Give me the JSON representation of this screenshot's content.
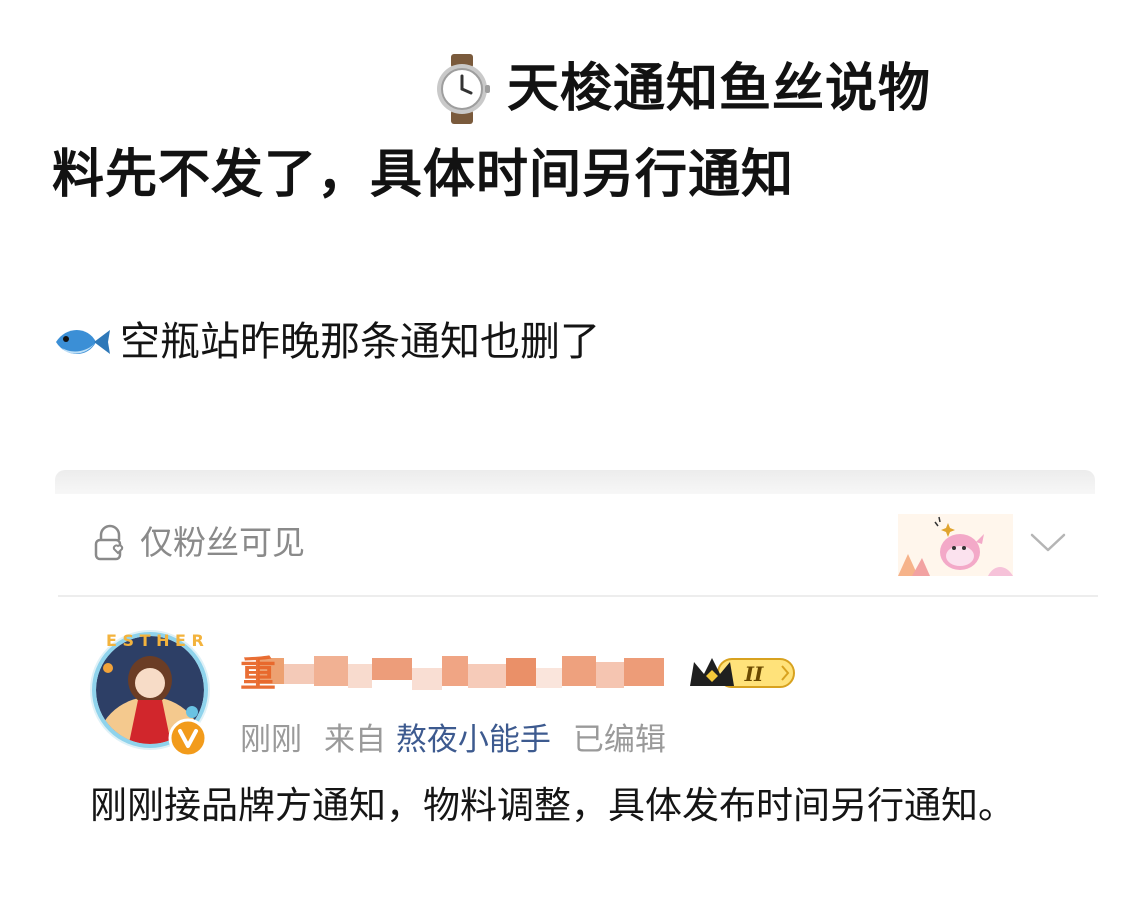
{
  "caption": {
    "emoji": "watch-emoji",
    "line1": "天梭通知鱼丝说物",
    "line2": "料先不发了，具体时间另行通知",
    "sub_emoji": "fish-emoji",
    "sub_text": "空瓶站昨晚那条通知也删了"
  },
  "post": {
    "visibility_label": "仅粉丝可见",
    "author": {
      "name_visible_prefix": "重",
      "name_obscured": true,
      "verified": true,
      "vip_level": "II"
    },
    "meta": {
      "time": "刚刚",
      "from_label": "来自",
      "source_app": "熬夜小能手",
      "edited_label": "已编辑"
    },
    "body_text": "刚刚接品牌方通知，物料调整，具体发布时间另行通知。"
  },
  "colors": {
    "source_link": "#3d5a8f",
    "meta_gray": "#9a9a9a",
    "username_orange": "#e8672a",
    "verified_orange": "#f29b1b"
  }
}
